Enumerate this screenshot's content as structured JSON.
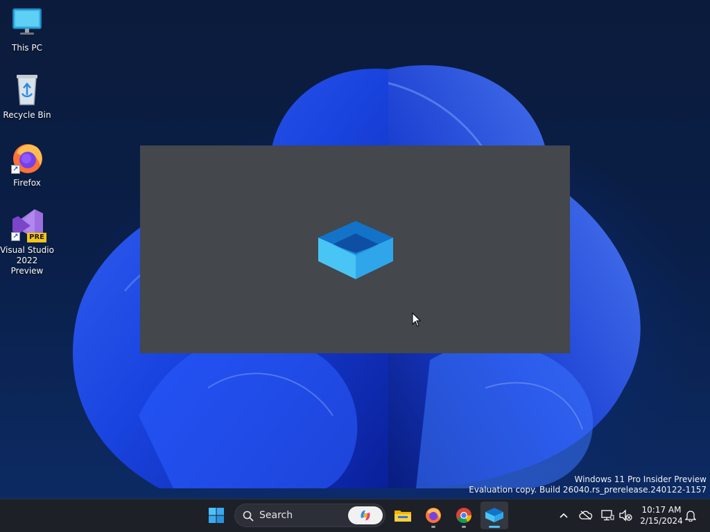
{
  "desktop": {
    "icons": [
      {
        "label": "This PC"
      },
      {
        "label": "Recycle Bin"
      },
      {
        "label": "Firefox"
      },
      {
        "label": "Visual Studio\n2022 Preview",
        "badge": "PRE"
      }
    ]
  },
  "splash": {
    "icon": "app-box-icon",
    "background": "#44474c"
  },
  "watermark": {
    "line1": "Windows 11 Pro Insider Preview",
    "line2": "Evaluation copy. Build 26040.rs_prerelease.240122-1157"
  },
  "taskbar": {
    "search_label": "Search",
    "apps": [
      "start-icon",
      "file-explorer-icon",
      "firefox-icon",
      "chrome-icon",
      "app-box-icon"
    ],
    "accent": "#4cc2ff"
  },
  "tray": {
    "time": "10:17 AM",
    "date": "2/15/2024",
    "icons": [
      "chevron-up-icon",
      "cloud-offline-icon",
      "network-icon",
      "volume-muted-icon",
      "notification-bell-icon"
    ]
  }
}
